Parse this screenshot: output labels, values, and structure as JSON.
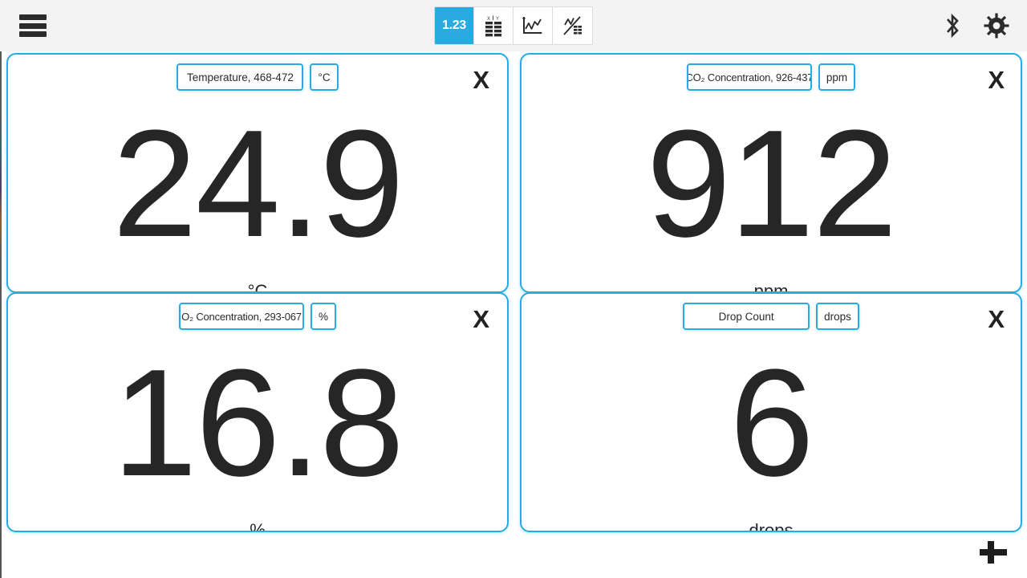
{
  "toolbar": {
    "menu_icon": "hamburger-menu-icon",
    "views": [
      {
        "id": "meter",
        "label": "1.23",
        "icon": "digits-meter-icon",
        "active": true
      },
      {
        "id": "table",
        "label": "",
        "icon": "data-table-icon",
        "active": false
      },
      {
        "id": "graph",
        "label": "",
        "icon": "line-graph-icon",
        "active": false
      },
      {
        "id": "graph-table",
        "label": "",
        "icon": "graph-and-table-icon",
        "active": false
      }
    ],
    "bluetooth_icon": "bluetooth-icon",
    "settings_icon": "gear-icon",
    "accent_color": "#29abe2",
    "background_color": "#f3f3f3"
  },
  "meters": [
    {
      "sensor": "Temperature, 468-472",
      "unit": "°C",
      "value": "24.9",
      "value_unit": "°C",
      "close_label": "X"
    },
    {
      "sensor": "CO₂ Concentration, 926-437",
      "unit": "ppm",
      "value": "912",
      "value_unit": "ppm",
      "close_label": "X"
    },
    {
      "sensor": "O₂ Concentration, 293-067",
      "unit": "%",
      "value": "16.8",
      "value_unit": "%",
      "close_label": "X"
    },
    {
      "sensor": "Drop Count",
      "unit": "drops",
      "value": "6",
      "value_unit": "drops",
      "close_label": "X"
    }
  ],
  "add_meter": {
    "icon": "plus-icon",
    "label": "+"
  }
}
